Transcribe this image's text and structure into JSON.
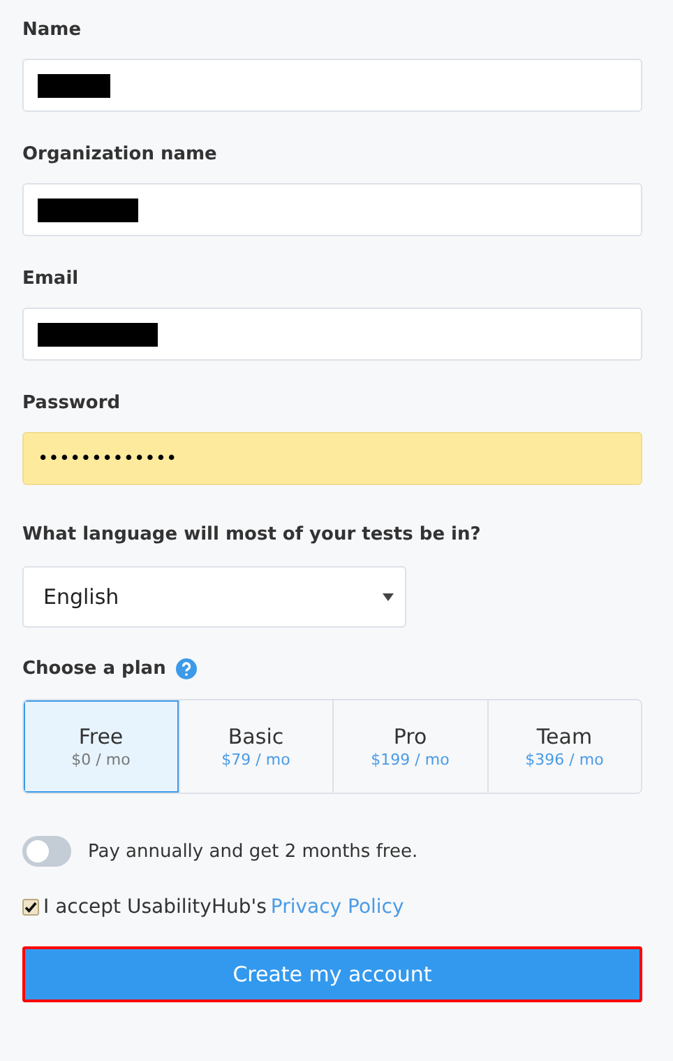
{
  "fields": [
    {
      "label": "Name",
      "redacted": true,
      "autofilled": false
    },
    {
      "label": "Organization name",
      "redacted": true,
      "autofilled": false
    },
    {
      "label": "Email",
      "redacted": true,
      "autofilled": false
    },
    {
      "label": "Password",
      "value": "•••••••••••••",
      "redacted": false,
      "autofilled": true
    }
  ],
  "language": {
    "label": "What language will most of your tests be in?",
    "value": "English"
  },
  "plan": {
    "label": "Choose a plan",
    "options": [
      {
        "name": "Free",
        "price": "$0 / mo",
        "selected": true
      },
      {
        "name": "Basic",
        "price": "$79 / mo",
        "selected": false
      },
      {
        "name": "Pro",
        "price": "$199 / mo",
        "selected": false
      },
      {
        "name": "Team",
        "price": "$396 / mo",
        "selected": false
      }
    ]
  },
  "annual_toggle": {
    "label": "Pay annually and get 2 months free.",
    "on": false
  },
  "terms": {
    "text": "I accept UsabilityHub's",
    "link": "Privacy Policy",
    "checked": true
  },
  "submit": {
    "label": "Create my account",
    "highlighted": true
  }
}
